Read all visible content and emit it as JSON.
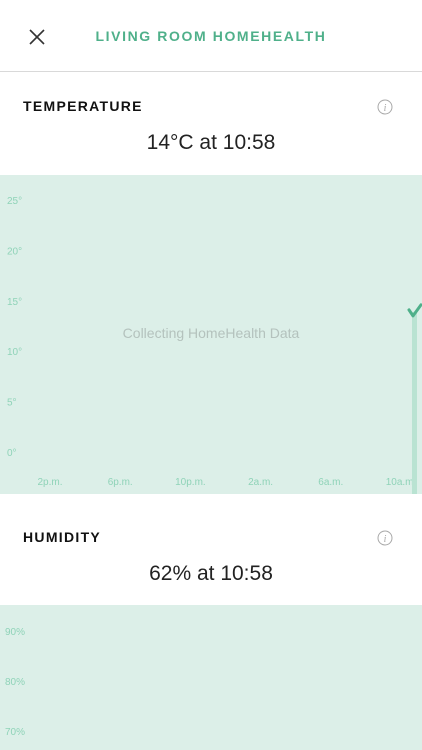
{
  "header": {
    "title": "LIVING ROOM HOMEHEALTH",
    "close_icon": "close-icon"
  },
  "temperature": {
    "title": "TEMPERATURE",
    "reading": "14°C at 10:58",
    "chart_data": {
      "type": "line",
      "y_ticks": [
        "25°",
        "20°",
        "15°",
        "10°",
        "5°",
        "0°"
      ],
      "y_values": [
        25,
        20,
        15,
        10,
        5,
        0
      ],
      "ylim": [
        0,
        25
      ],
      "x_ticks": [
        "2p.m.",
        "6p.m.",
        "10p.m.",
        "2a.m.",
        "6a.m.",
        "10a.m."
      ],
      "empty_message": "Collecting HomeHealth Data",
      "current_value": 14
    }
  },
  "humidity": {
    "title": "HUMIDITY",
    "reading": "62% at 10:58",
    "chart_data": {
      "type": "line",
      "y_ticks": [
        "90%",
        "80%",
        "70%"
      ],
      "y_values": [
        90,
        80,
        70
      ]
    }
  },
  "colors": {
    "accent": "#4fb08a",
    "chart_bg": "#dcefe8",
    "tick": "#8fd3b8"
  }
}
